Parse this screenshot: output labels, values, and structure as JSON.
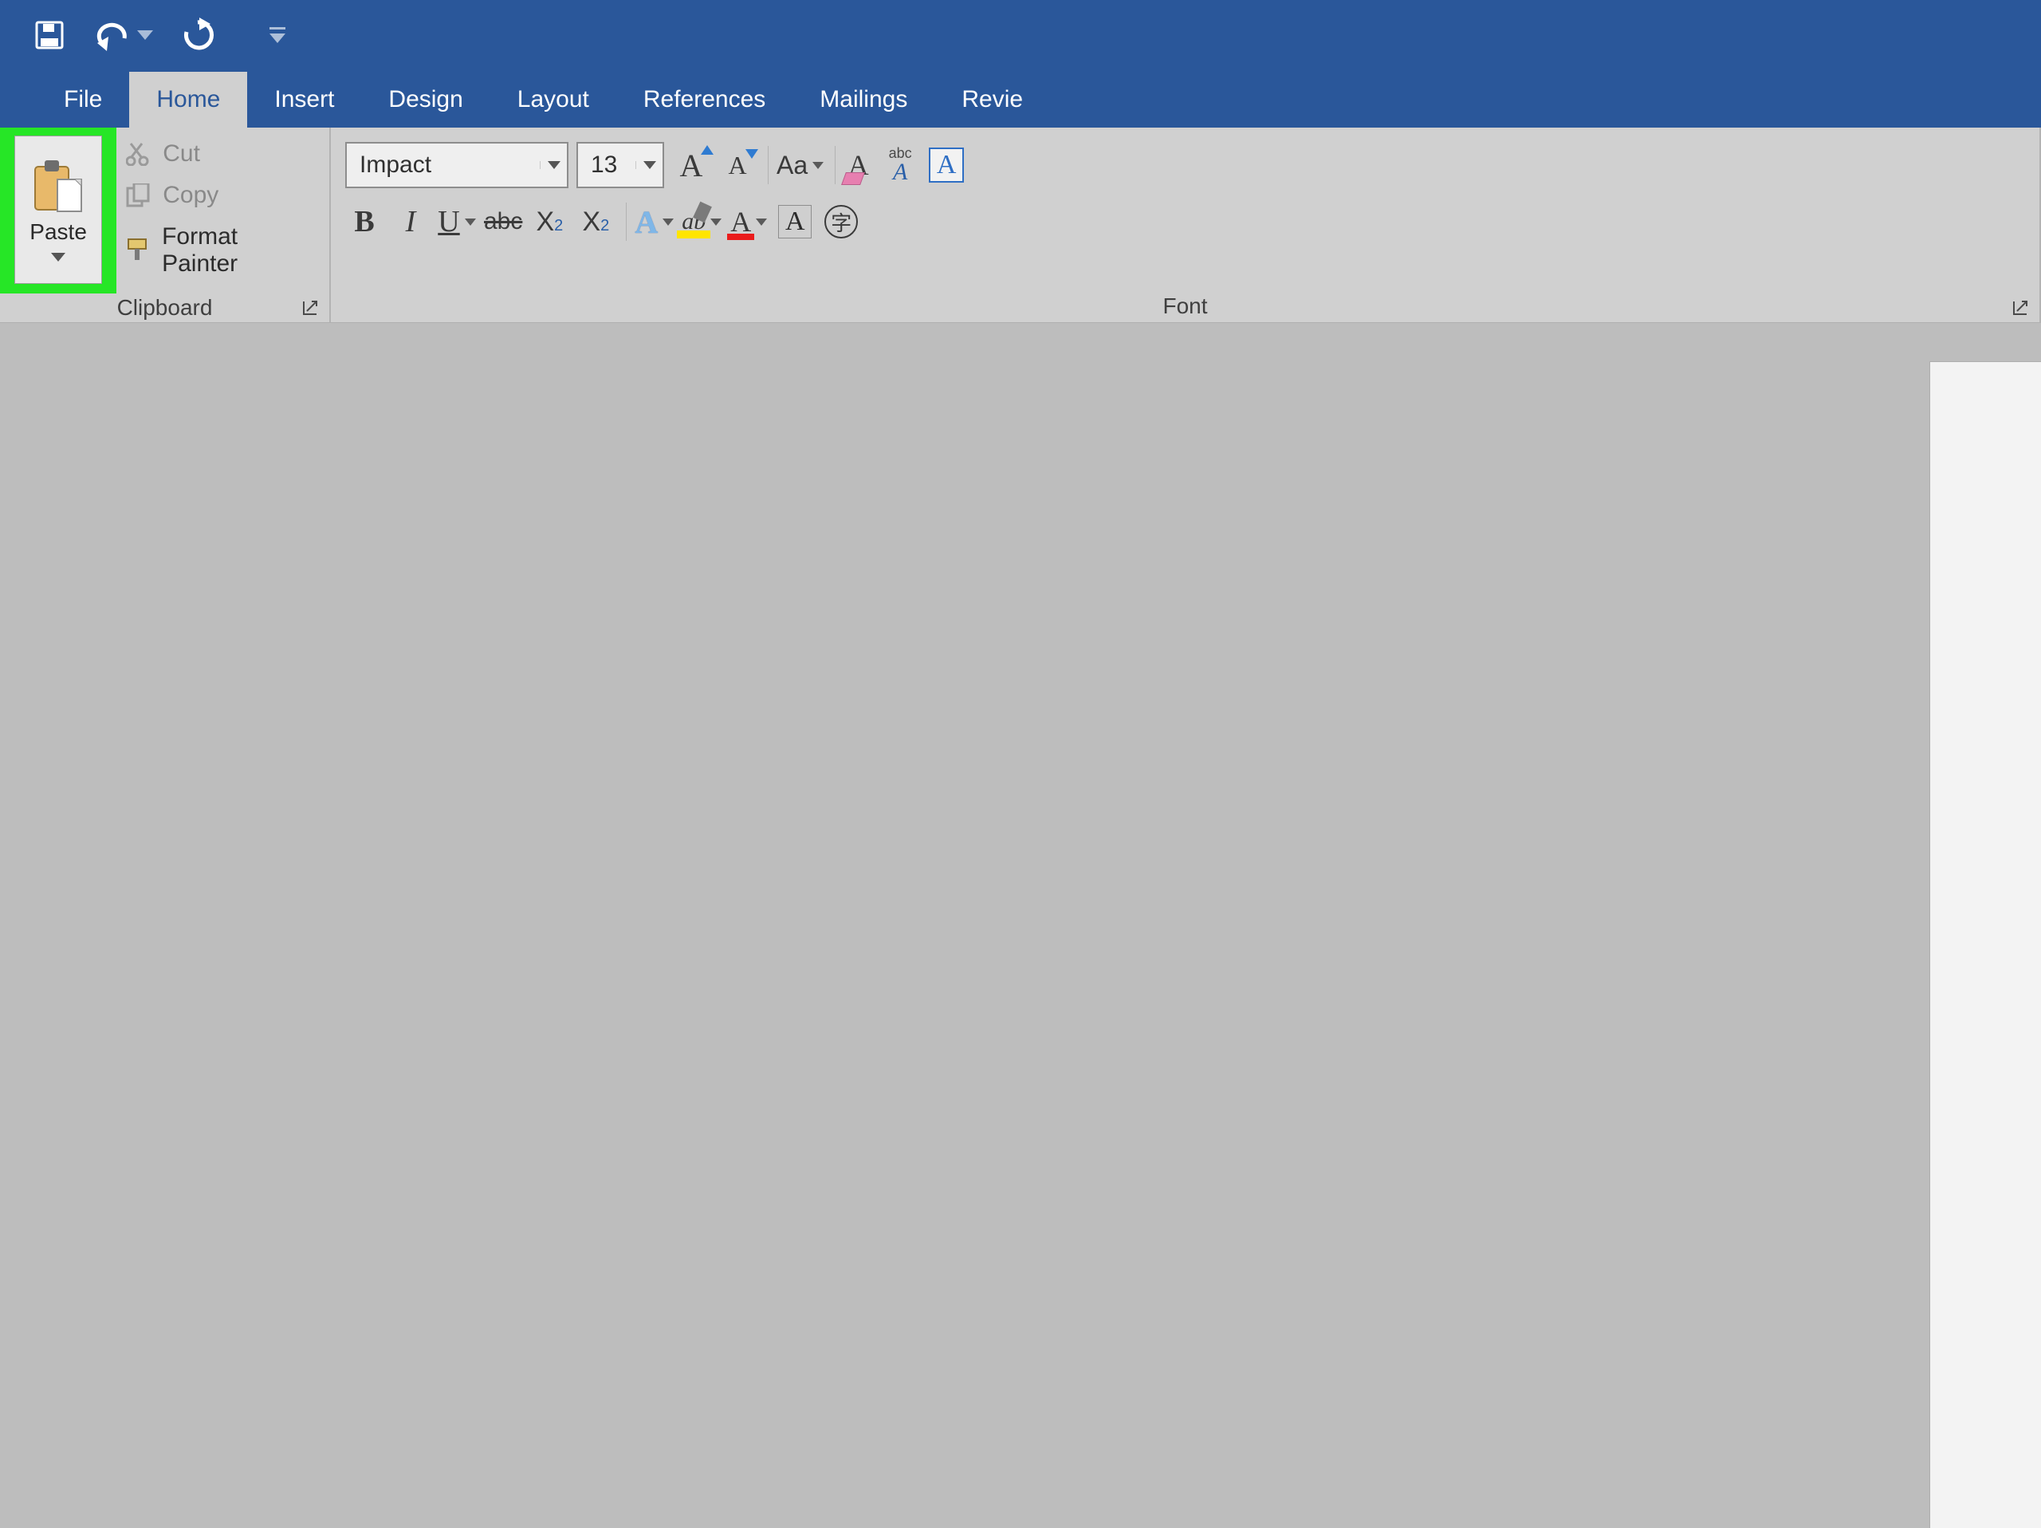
{
  "tabs": {
    "file": "File",
    "home": "Home",
    "insert": "Insert",
    "design": "Design",
    "layout": "Layout",
    "references": "References",
    "mailings": "Mailings",
    "review": "Revie"
  },
  "clipboard": {
    "paste": "Paste",
    "cut": "Cut",
    "copy": "Copy",
    "format_painter": "Format Painter",
    "group_label": "Clipboard"
  },
  "font": {
    "name": "Impact",
    "size": "13",
    "case_label": "Aa",
    "abc_script": "abc",
    "group_label": "Font",
    "circle_char": "字"
  }
}
